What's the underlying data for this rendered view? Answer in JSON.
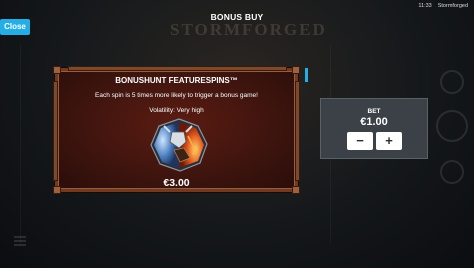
{
  "status_bar": {
    "time": "11:33",
    "app_name": "Stormforged"
  },
  "header": {
    "title": "BONUS BUY"
  },
  "close_button": {
    "label": "Close"
  },
  "feature": {
    "title": "BONUSHUNT FEATURESPINS™",
    "description": "Each spin is 5 times more likely to trigger a bonus game!",
    "volatility": "Volatility: Very high",
    "price": "€3.00"
  },
  "bet": {
    "label": "BET",
    "value": "€1.00",
    "decrease_label": "−",
    "increase_label": "+"
  },
  "colors": {
    "accent": "#23aee6",
    "card_background": "#3d140e",
    "card_frame": "#6e3a22",
    "bet_panel": "#3b4146"
  }
}
